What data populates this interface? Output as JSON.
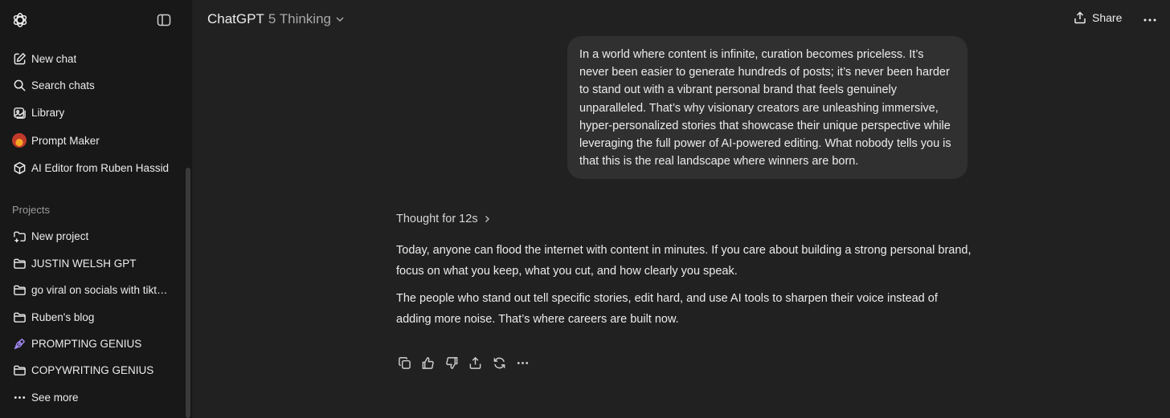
{
  "sidebar": {
    "top_items": [
      {
        "label": "New chat",
        "icon": "edit-icon"
      },
      {
        "label": "Search chats",
        "icon": "search-icon"
      },
      {
        "label": "Library",
        "icon": "library-icon"
      },
      {
        "label": "Prompt Maker",
        "icon": "gpt-avatar"
      },
      {
        "label": "AI Editor from Ruben Hassid",
        "icon": "cube-icon"
      }
    ],
    "projects_label": "Projects",
    "project_items": [
      {
        "label": "New project",
        "icon": "folder-plus-icon"
      },
      {
        "label": "JUSTIN WELSH GPT",
        "icon": "folder-icon"
      },
      {
        "label": "go viral on socials with tikt…",
        "icon": "folder-icon"
      },
      {
        "label": "Ruben's blog",
        "icon": "folder-icon"
      },
      {
        "label": "PROMPTING GENIUS",
        "icon": "pen-nib-icon"
      },
      {
        "label": "COPYWRITING GENIUS",
        "icon": "folder-icon"
      },
      {
        "label": "See more",
        "icon": "ellipsis-icon"
      }
    ]
  },
  "header": {
    "model_name": "ChatGPT",
    "model_variant": "5 Thinking",
    "share_label": "Share"
  },
  "conversation": {
    "user_message": "In a world where content is infinite, curation becomes priceless. It’s never been easier to generate hundreds of posts; it’s never been harder to stand out with a vibrant personal brand that feels genuinely unparalleled. That’s why visionary creators are unleashing immersive, hyper-personalized stories that showcase their unique perspective while leveraging the full power of AI-powered editing. What nobody tells you is that this is the real landscape where winners are born.",
    "thought_label": "Thought for 12s",
    "assistant_paragraphs": [
      "Today, anyone can flood the internet with content in minutes. If you care about building a strong personal brand, focus on what you keep, what you cut, and how clearly you speak.",
      "The people who stand out tell specific stories, edit hard, and use AI tools to sharpen their voice instead of adding more noise. That’s where careers are built now."
    ],
    "action_icons": [
      "copy-icon",
      "thumbs-up-icon",
      "thumbs-down-icon",
      "share-icon",
      "regenerate-icon",
      "more-icon"
    ]
  },
  "colors": {
    "sidebar_bg": "#181818",
    "main_bg": "#212121",
    "bubble_bg": "#303030",
    "accent_purple": "#a78bfa"
  }
}
